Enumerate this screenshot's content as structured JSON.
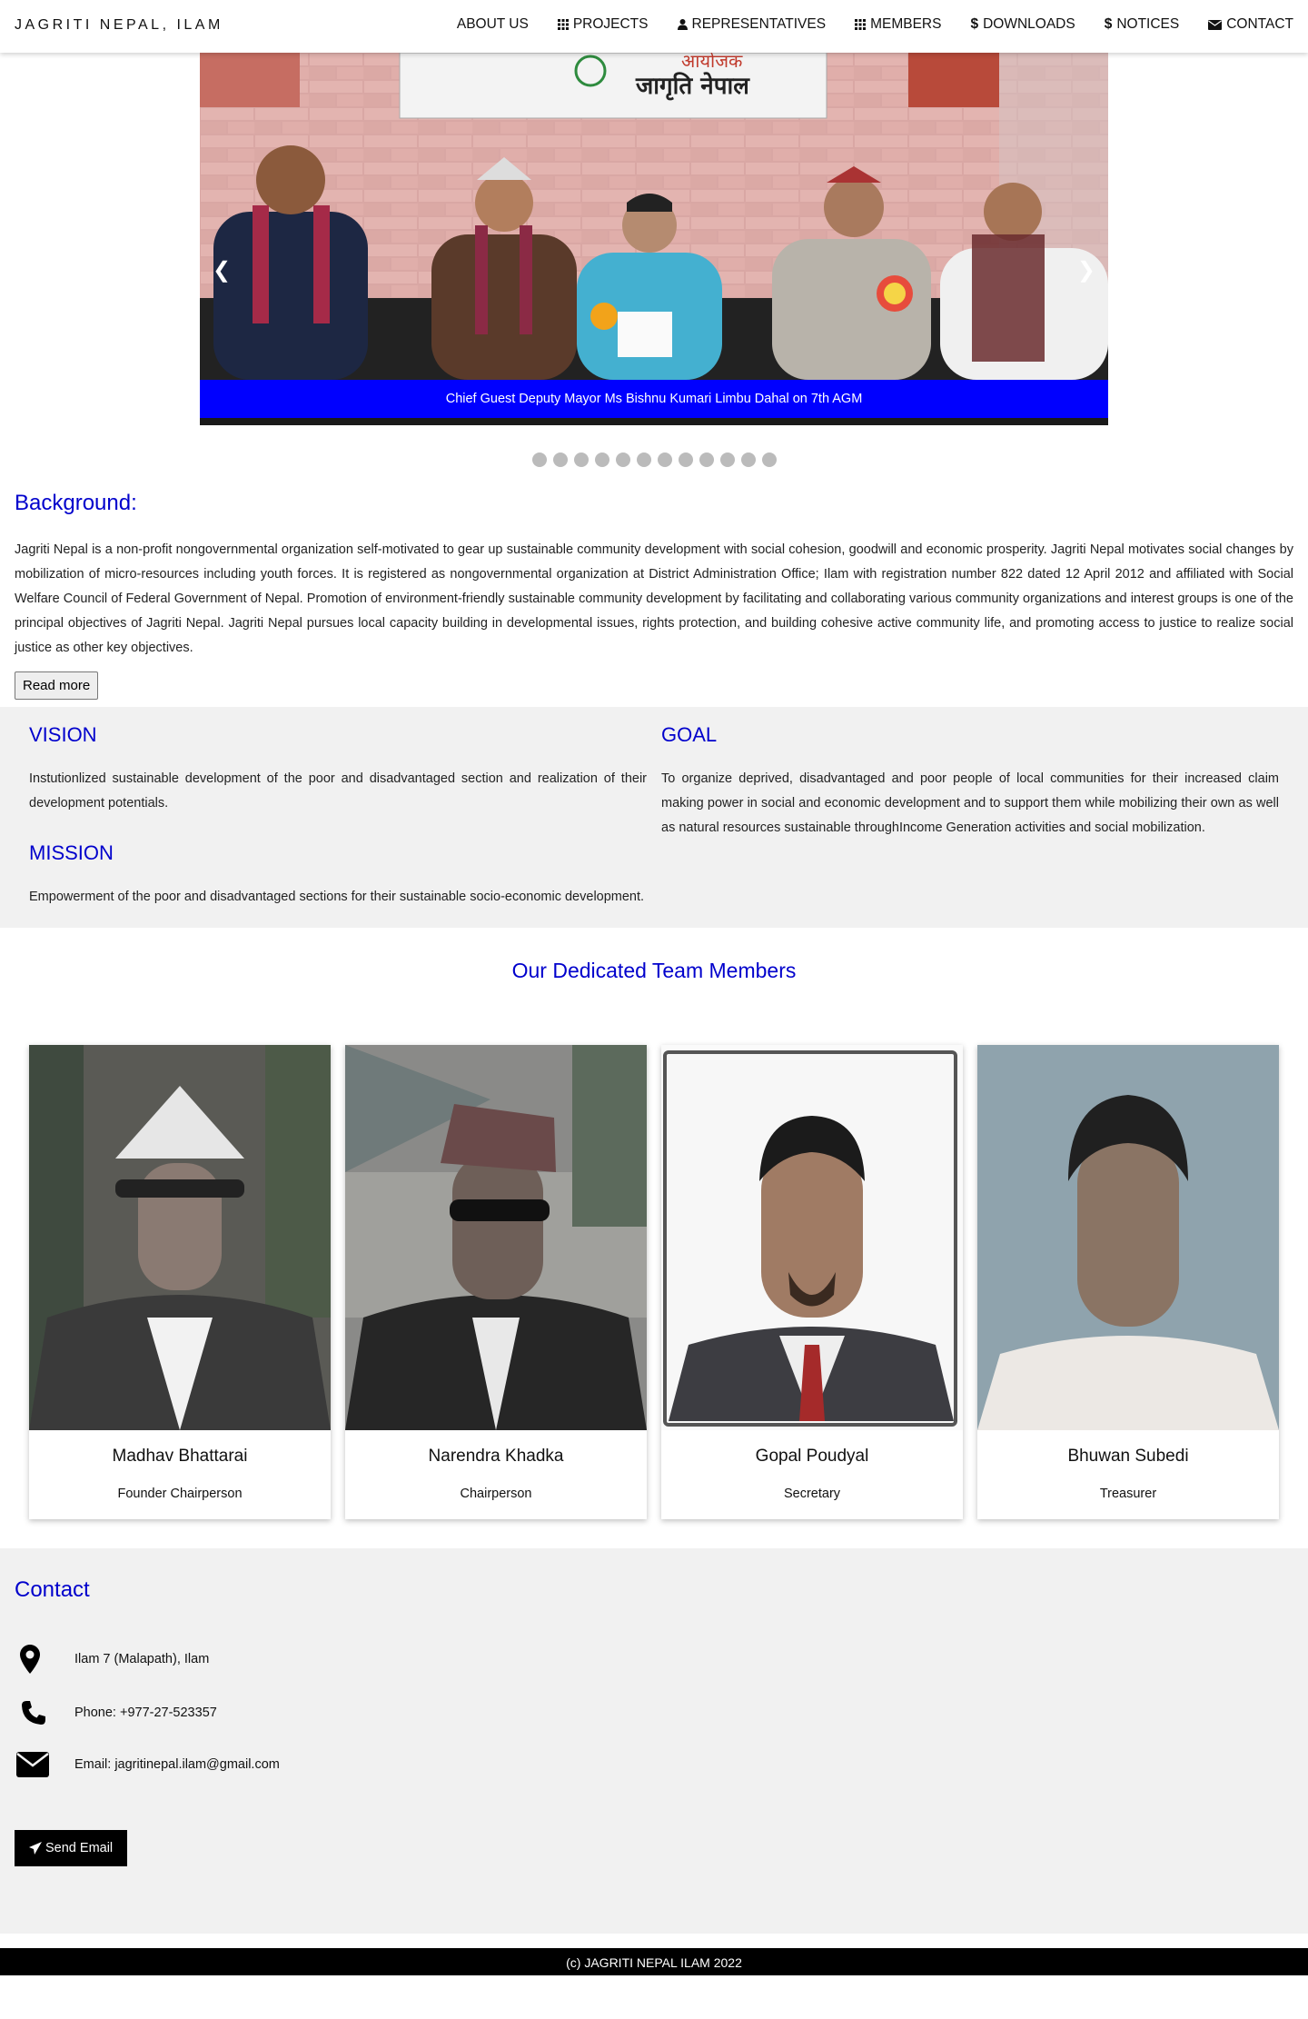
{
  "brand": "JAGRITI NEPAL, ILAM",
  "nav": [
    {
      "label": "ABOUT US",
      "icon": "none"
    },
    {
      "label": "PROJECTS",
      "icon": "grid-icon"
    },
    {
      "label": "REPRESENTATIVES",
      "icon": "user-icon"
    },
    {
      "label": "MEMBERS",
      "icon": "grid-icon"
    },
    {
      "label": "DOWNLOADS",
      "icon": "dollar-icon"
    },
    {
      "label": "NOTICES",
      "icon": "dollar-icon"
    },
    {
      "label": "CONTACT",
      "icon": "envelope-icon"
    }
  ],
  "slider": {
    "caption": "Chief Guest Deputy Mayor Ms Bishnu Kumari Limbu Dahal on 7th AGM",
    "banner_line1": "आयोजक",
    "banner_line2": "जागृति नेपाल",
    "prev": "❮",
    "next": "❯",
    "dot_count": 12
  },
  "background": {
    "title": "Background:",
    "text": "Jagriti Nepal is a non-profit nongovernmental organization self-motivated to gear up sustainable community development with social cohesion, goodwill and economic prosperity. Jagriti Nepal motivates social changes by mobilization of micro-resources including youth forces. It is registered as nongovernmental organization at District Administration Office; Ilam with registration number 822 dated 12 April 2012 and affiliated with Social Welfare Council of Federal Government of Nepal. Promotion of environment-friendly sustainable community development by facilitating and collaborating various community organizations and interest groups is one of the principal objectives of Jagriti Nepal. Jagriti Nepal pursues local capacity building in developmental issues, rights protection, and building cohesive active community life, and promoting access to justice to realize social justice as other key objectives.",
    "read_more": "Read more"
  },
  "vision": {
    "title": "VISION",
    "text": "Instutionlized sustainable development of the poor and disadvantaged section and realization of their development potentials."
  },
  "mission": {
    "title": "MISSION",
    "text": "Empowerment of the poor and disadvantaged sections for their sustainable socio-economic development."
  },
  "goal": {
    "title": "GOAL",
    "text": "To organize deprived, disadvantaged and poor people of local communities for their increased claim making power in social and economic development and to support them while mobilizing their own as well as natural resources sustainable throughIncome Generation activities and social mobilization."
  },
  "team": {
    "title": "Our Dedicated Team Members",
    "members": [
      {
        "name": "Madhav Bhattarai",
        "role": "Founder Chairperson"
      },
      {
        "name": "Narendra Khadka",
        "role": "Chairperson"
      },
      {
        "name": "Gopal Poudyal",
        "role": "Secretary"
      },
      {
        "name": "Bhuwan Subedi",
        "role": "Treasurer"
      }
    ]
  },
  "contact": {
    "title": "Contact",
    "address": "Ilam 7 (Malapath), Ilam",
    "phone": "Phone: +977-27-523357",
    "email": "Email: jagritinepal.ilam@gmail.com",
    "send": "Send Email"
  },
  "footer": "(c) JAGRITI NEPAL ILAM 2022"
}
